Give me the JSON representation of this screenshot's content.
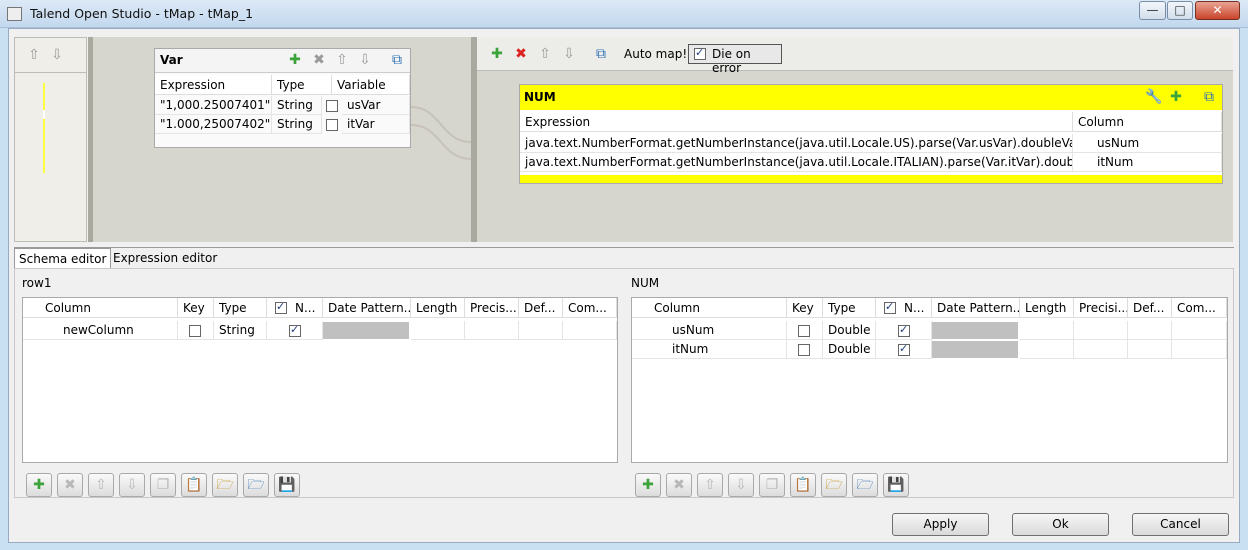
{
  "window": {
    "title": "Talend Open Studio - tMap - tMap_1"
  },
  "var_table": {
    "title": "Var",
    "headers": [
      "Expression",
      "Type",
      "Variable"
    ],
    "rows": [
      {
        "expression": "\"1,000.25007401\"",
        "type": "String",
        "variable": "usVar"
      },
      {
        "expression": "\"1.000,25007402\"",
        "type": "String",
        "variable": "itVar"
      }
    ]
  },
  "output_toolbar": {
    "auto_map": "Auto map!",
    "die_on_error": "Die on error"
  },
  "output_table": {
    "title": "NUM",
    "headers": [
      "Expression",
      "Column"
    ],
    "rows": [
      {
        "expression": "java.text.NumberFormat.getNumberInstance(java.util.Locale.US).parse(Var.usVar).doubleValue()",
        "column": "usNum"
      },
      {
        "expression": "java.text.NumberFormat.getNumberInstance(java.util.Locale.ITALIAN).parse(Var.itVar).doubleValue()",
        "column": "itNum"
      }
    ],
    "header_color": "#ffff00"
  },
  "tabs": [
    "Schema editor",
    "Expression editor"
  ],
  "schema_headers": [
    "Column",
    "Key",
    "Type",
    "N...",
    "Date Pattern...",
    "Length",
    "Precis...",
    "Def...",
    "Com..."
  ],
  "schema_headers_right": [
    "Column",
    "Key",
    "Type",
    "N...",
    "Date Pattern...",
    "Length",
    "Precisi...",
    "Def...",
    "Com..."
  ],
  "schema_left": {
    "title": "row1",
    "rows": [
      {
        "column": "newColumn",
        "type": "String",
        "key": false,
        "nullable": true
      }
    ]
  },
  "schema_right": {
    "title": "NUM",
    "rows": [
      {
        "column": "usNum",
        "type": "Double",
        "key": false,
        "nullable": true
      },
      {
        "column": "itNum",
        "type": "Double",
        "key": false,
        "nullable": true
      }
    ]
  },
  "buttons": {
    "apply": "Apply",
    "ok": "Ok",
    "cancel": "Cancel"
  },
  "icons": {
    "add": "plus-icon",
    "remove": "remove-icon",
    "up": "arrow-up-icon",
    "down": "arrow-down-icon",
    "minimize": "minimize-icon",
    "save": "save-icon"
  }
}
